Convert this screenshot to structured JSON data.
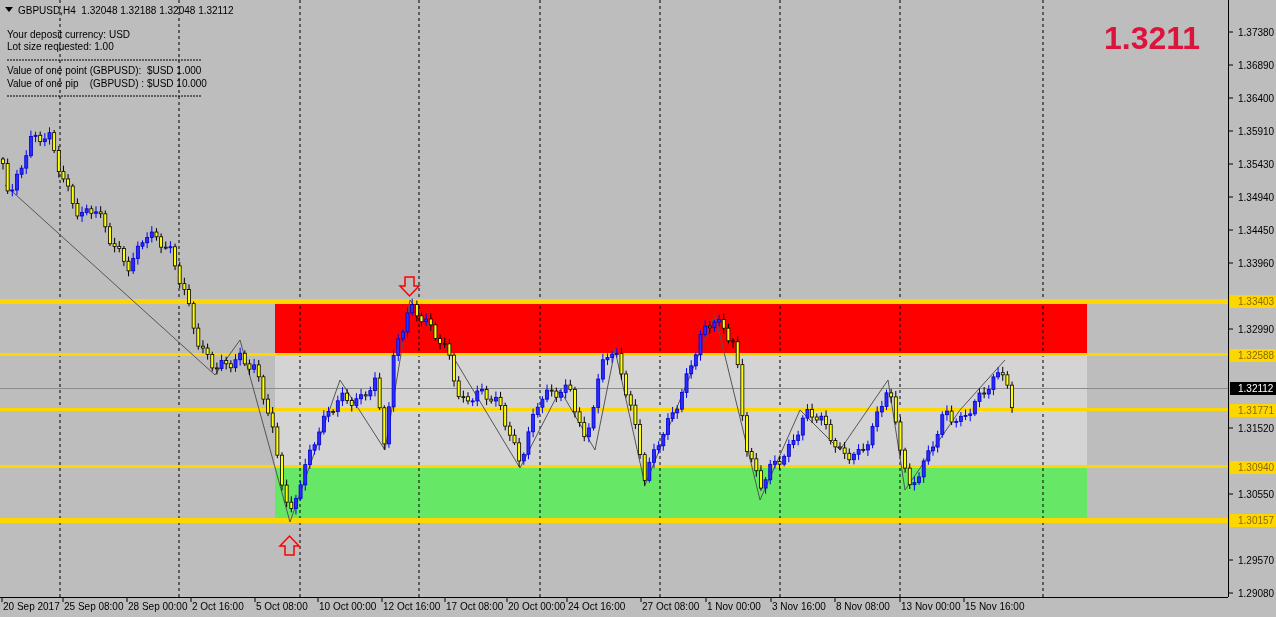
{
  "symbol_header": {
    "symbol": "GBPUSD,H4",
    "ohlc": "1.32048 1.32188 1.32048 1.32112"
  },
  "info_lines": [
    "Your deposit currency: USD",
    "Lot size requested: 1.00",
    "Value of one point (GBPUSD):  $USD 1.000",
    "Value of one pip    (GBPUSD) : $USD 10.000"
  ],
  "current_price_big": "1.3211",
  "price_axis": {
    "ticks": [
      "1.37380",
      "1.36890",
      "1.36400",
      "1.35910",
      "1.35430",
      "1.34940",
      "1.34450",
      "1.33960",
      "1.32990",
      "1.31520",
      "1.30550",
      "1.29570",
      "1.29080"
    ],
    "level_labels": [
      "1.33403",
      "1.32588",
      "1.31771",
      "1.30940",
      "1.30157"
    ],
    "current_price_label": "1.32112"
  },
  "time_axis": {
    "labels": [
      "20 Sep 2017",
      "25 Sep 08:00",
      "28 Sep 00:00",
      "2 Oct 16:00",
      "5 Oct 08:00",
      "10 Oct 00:00",
      "12 Oct 16:00",
      "17 Oct 08:00",
      "20 Oct 00:00",
      "24 Oct 16:00",
      "27 Oct 08:00",
      "1 Nov 00:00",
      "3 Nov 16:00",
      "8 Nov 08:00",
      "13 Nov 00:00",
      "15 Nov 16:00"
    ]
  }
}
